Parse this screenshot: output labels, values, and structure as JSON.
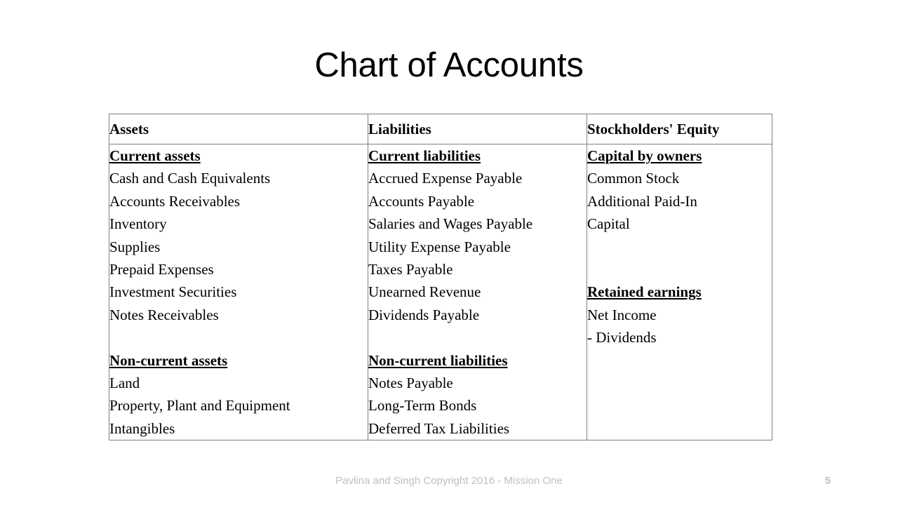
{
  "slide": {
    "title": "Chart of Accounts",
    "page_number": "5",
    "footer_credit": "Pavlina and Singh Copyright 2016 - Mission One",
    "footer_color": "#bfbfbf",
    "border_color": "#808080",
    "text_color": "#000000",
    "background": "#ffffff"
  },
  "table": {
    "headers": [
      "Assets",
      "Liabilities",
      "Stockholders' Equity"
    ],
    "columns": [
      {
        "header": "Assets",
        "lines": [
          {
            "text": "Current assets",
            "style": "section"
          },
          {
            "text": "Cash and Cash Equivalents",
            "style": "item"
          },
          {
            "text": "Accounts Receivables",
            "style": "item"
          },
          {
            "text": "Inventory",
            "style": "item"
          },
          {
            "text": "Supplies",
            "style": "item"
          },
          {
            "text": "Prepaid Expenses",
            "style": "item"
          },
          {
            "text": "Investment Securities",
            "style": "item"
          },
          {
            "text": "Notes Receivables",
            "style": "item"
          },
          {
            "text": "",
            "style": "spacer"
          },
          {
            "text": "Non-current assets",
            "style": "section"
          },
          {
            "text": "Land",
            "style": "item"
          },
          {
            "text": "Property, Plant and Equipment",
            "style": "item"
          },
          {
            "text": "Intangibles",
            "style": "item"
          }
        ]
      },
      {
        "header": "Liabilities",
        "lines": [
          {
            "text": "Current liabilities",
            "style": "section"
          },
          {
            "text": "Accrued Expense Payable",
            "style": "item"
          },
          {
            "text": "Accounts Payable",
            "style": "item"
          },
          {
            "text": "Salaries and Wages Payable",
            "style": "item"
          },
          {
            "text": "Utility Expense Payable",
            "style": "item"
          },
          {
            "text": "Taxes Payable",
            "style": "item"
          },
          {
            "text": "Unearned Revenue",
            "style": "item"
          },
          {
            "text": "Dividends Payable",
            "style": "item"
          },
          {
            "text": "",
            "style": "spacer"
          },
          {
            "text": "Non-current liabilities",
            "style": "section"
          },
          {
            "text": "Notes Payable",
            "style": "item"
          },
          {
            "text": "Long-Term Bonds",
            "style": "item"
          },
          {
            "text": "Deferred Tax Liabilities",
            "style": "item"
          }
        ]
      },
      {
        "header": "Stockholders' Equity",
        "lines": [
          {
            "text": "Capital by owners",
            "style": "section"
          },
          {
            "text": "Common Stock",
            "style": "item"
          },
          {
            "text": "Additional Paid-In",
            "style": "item"
          },
          {
            "text": "Capital",
            "style": "item"
          },
          {
            "text": "",
            "style": "spacer"
          },
          {
            "text": "",
            "style": "spacer"
          },
          {
            "text": "Retained earnings",
            "style": "section"
          },
          {
            "text": "Net Income",
            "style": "item"
          },
          {
            "text": "- Dividends",
            "style": "item"
          }
        ]
      }
    ]
  }
}
